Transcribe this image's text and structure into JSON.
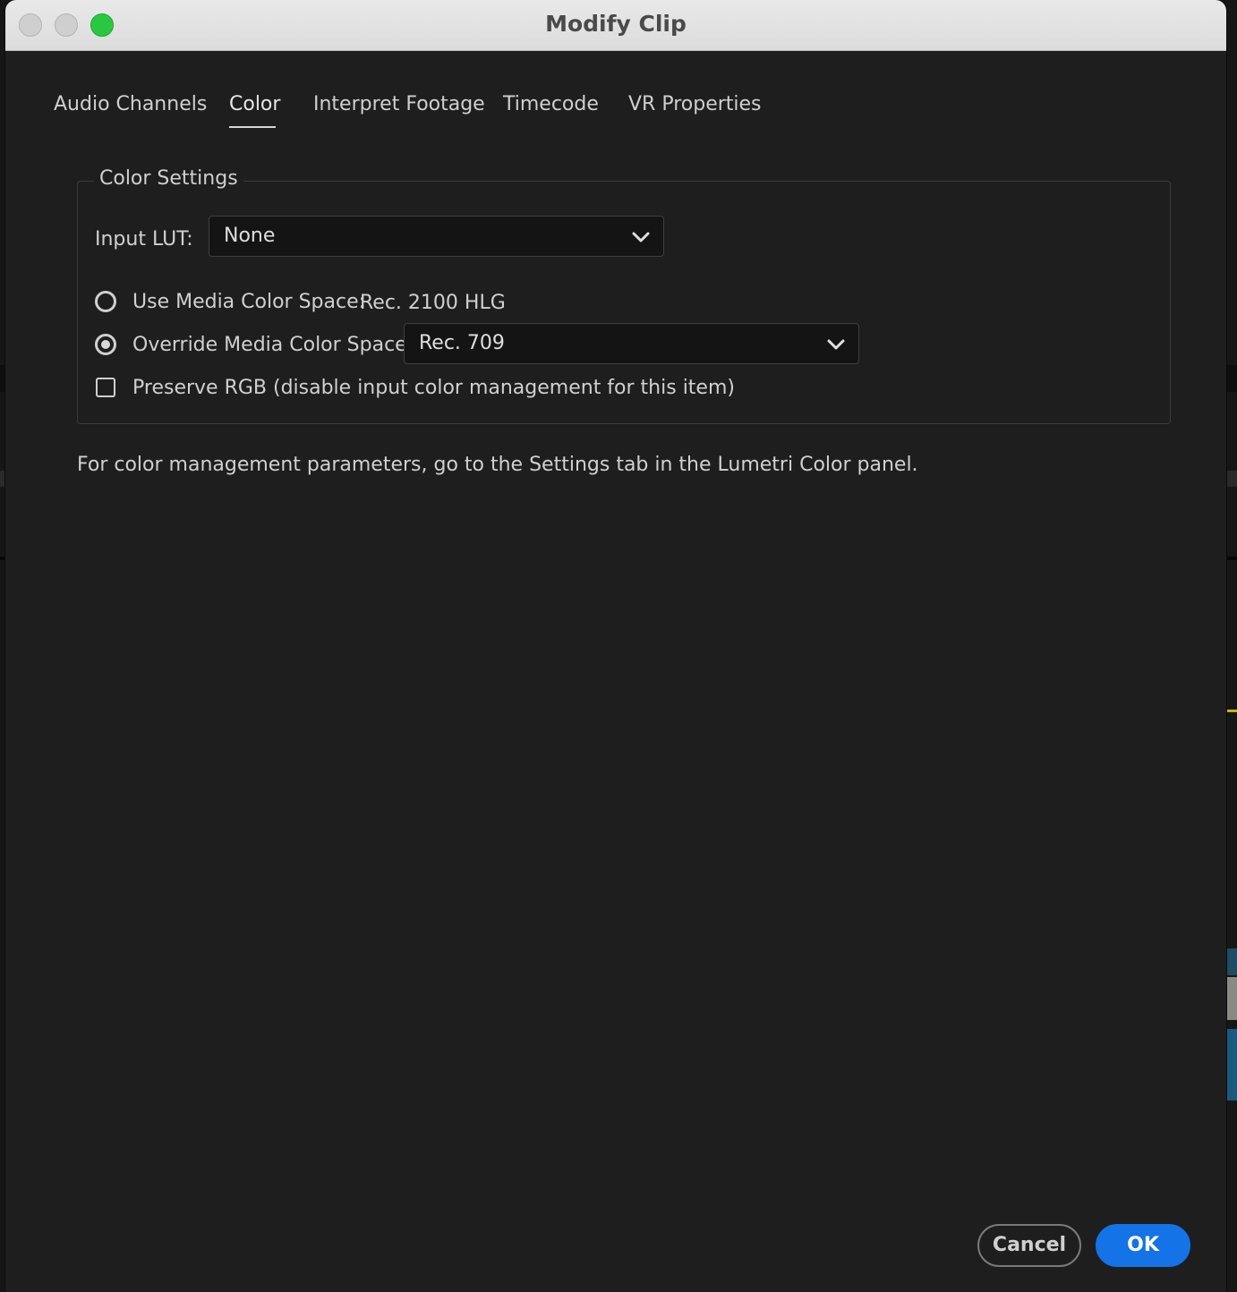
{
  "window": {
    "title": "Modify Clip",
    "controls": [
      "close",
      "minimize",
      "zoom"
    ]
  },
  "tabs": [
    {
      "label": "Audio Channels",
      "active": false
    },
    {
      "label": "Color",
      "active": true
    },
    {
      "label": "Interpret Footage",
      "active": false
    },
    {
      "label": "Timecode",
      "active": false
    },
    {
      "label": "VR Properties",
      "active": false
    }
  ],
  "color_settings": {
    "group_label": "Color Settings",
    "input_lut": {
      "label": "Input LUT:",
      "value": "None"
    },
    "use_media_color_space": {
      "label": "Use Media Color Space:",
      "value": "Rec. 2100 HLG",
      "selected": false
    },
    "override_media_color_space": {
      "label": "Override Media Color Space:",
      "value": "Rec. 709",
      "selected": true
    },
    "preserve_rgb": {
      "label": "Preserve RGB (disable input color management for this item)",
      "checked": false
    }
  },
  "note": "For color management parameters, go to the Settings tab in the Lumetri Color panel.",
  "buttons": {
    "cancel": "Cancel",
    "ok": "OK"
  },
  "colors": {
    "accent": "#1473e6",
    "background": "#1e1e1e",
    "titlebar": "#e3e3e3"
  }
}
